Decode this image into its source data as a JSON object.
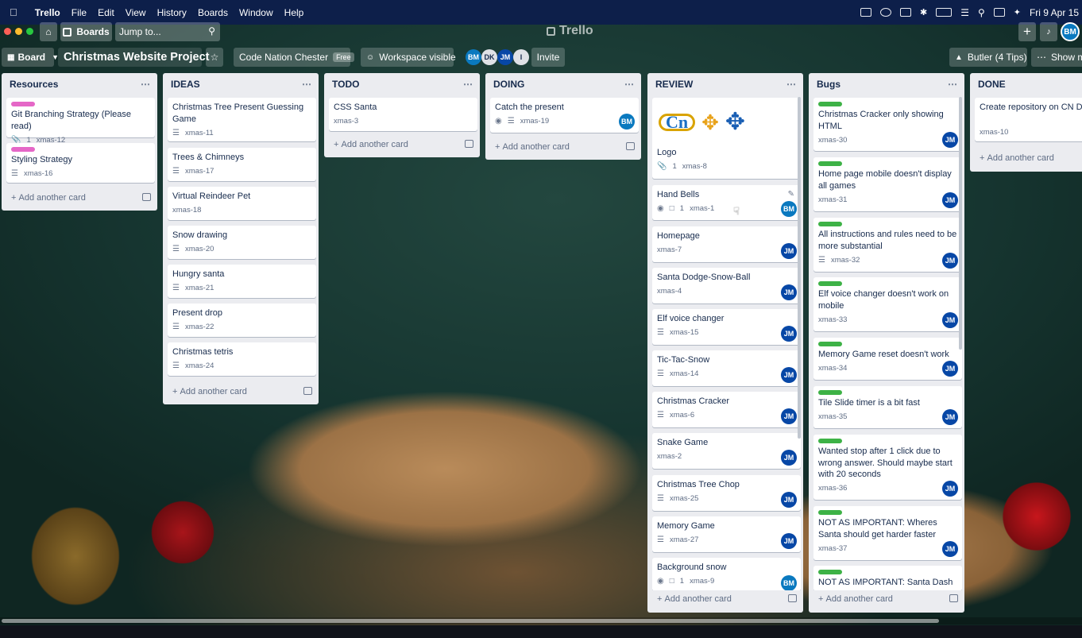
{
  "menubar": {
    "app": "Trello",
    "items": [
      "File",
      "Edit",
      "View",
      "History",
      "Boards",
      "Window",
      "Help"
    ],
    "clock": "Fri 9 Apr  15"
  },
  "nav": {
    "boards": "Boards",
    "search_placeholder": "Jump to...",
    "logo": "Trello",
    "user_initials": "BM"
  },
  "board": {
    "view": "Board",
    "title": "Christmas Website Project",
    "workspace": "Code Nation Chester",
    "plan": "Free",
    "visibility": "Workspace visible",
    "members": [
      "BM",
      "DK",
      "JM",
      "I"
    ],
    "invite": "Invite",
    "butler": "Butler (4 Tips)",
    "show_menu": "Show me"
  },
  "add_card": "Add another card",
  "lists": [
    {
      "title": "Resources",
      "cards": [
        {
          "title": "Git Branching Strategy (Please read)",
          "label": "pink",
          "attach": "1",
          "id": "xmas-12"
        },
        {
          "title": "Styling Strategy",
          "label": "pink",
          "desc": true,
          "id": "xmas-16"
        }
      ]
    },
    {
      "title": "IDEAS",
      "cards": [
        {
          "title": "Christmas Tree Present Guessing Game",
          "desc": true,
          "id": "xmas-11"
        },
        {
          "title": "Trees & Chimneys",
          "desc": true,
          "id": "xmas-17"
        },
        {
          "title": "Virtual Reindeer Pet",
          "id": "xmas-18"
        },
        {
          "title": "Snow drawing",
          "desc": true,
          "id": "xmas-20"
        },
        {
          "title": "Hungry santa",
          "desc": true,
          "id": "xmas-21"
        },
        {
          "title": "Present drop",
          "desc": true,
          "id": "xmas-22"
        },
        {
          "title": "Christmas tetris",
          "desc": true,
          "id": "xmas-24"
        }
      ]
    },
    {
      "title": "TODO",
      "cards": [
        {
          "title": "CSS Santa",
          "id": "xmas-3"
        }
      ]
    },
    {
      "title": "DOING",
      "cards": [
        {
          "title": "Catch the present",
          "watch": true,
          "desc": true,
          "id": "xmas-19",
          "member": "BM"
        }
      ]
    },
    {
      "title": "REVIEW",
      "cards": [
        {
          "title": "Logo",
          "cover": "Cn",
          "attach": "1",
          "id": "xmas-8"
        },
        {
          "title": "Hand Bells",
          "watch": true,
          "comments": "1",
          "id": "xmas-1",
          "member": "BM"
        },
        {
          "title": "Homepage",
          "id": "xmas-7",
          "member": "JM"
        },
        {
          "title": "Santa Dodge-Snow-Ball",
          "id": "xmas-4",
          "member": "JM"
        },
        {
          "title": "Elf voice changer",
          "desc": true,
          "id": "xmas-15",
          "member": "JM"
        },
        {
          "title": "Tic-Tac-Snow",
          "desc": true,
          "id": "xmas-14",
          "member": "JM"
        },
        {
          "title": "Christmas Cracker",
          "desc": true,
          "id": "xmas-6",
          "member": "JM"
        },
        {
          "title": "Snake Game",
          "id": "xmas-2",
          "member": "JM"
        },
        {
          "title": "Christmas Tree Chop",
          "desc": true,
          "id": "xmas-25",
          "member": "JM"
        },
        {
          "title": "Memory Game",
          "desc": true,
          "id": "xmas-27",
          "member": "JM"
        },
        {
          "title": "Background snow",
          "watch": true,
          "comments": "1",
          "id": "xmas-9",
          "member": "BM"
        }
      ]
    },
    {
      "title": "Bugs",
      "cards": [
        {
          "title": "Christmas Cracker only showing HTML",
          "label": "green",
          "id": "xmas-30",
          "member": "JM"
        },
        {
          "title": "Home page mobile doesn't display all games",
          "label": "green",
          "id": "xmas-31",
          "member": "JM"
        },
        {
          "title": "All instructions and rules need to be more substantial",
          "label": "green",
          "desc": true,
          "id": "xmas-32",
          "member": "JM"
        },
        {
          "title": "Elf voice changer doesn't work on mobile",
          "label": "green",
          "id": "xmas-33",
          "member": "JM"
        },
        {
          "title": "Memory Game reset doesn't work",
          "label": "green",
          "id": "xmas-34",
          "member": "JM"
        },
        {
          "title": "Tile Slide timer is a bit fast",
          "label": "green",
          "id": "xmas-35",
          "member": "JM"
        },
        {
          "title": "Wanted stop after 1 click due to wrong answer. Should maybe start with 20 seconds",
          "label": "green",
          "id": "xmas-36",
          "member": "JM"
        },
        {
          "title": "NOT AS IMPORTANT: Wheres Santa should get harder faster",
          "label": "green",
          "id": "xmas-37",
          "member": "JM"
        },
        {
          "title": "NOT AS IMPORTANT: Santa Dash",
          "label": "green"
        }
      ]
    },
    {
      "title": "DONE",
      "cards": [
        {
          "title": "Create repository on CN Digi Github",
          "id": "xmas-10"
        }
      ]
    }
  ],
  "colors": {
    "menubar": "#0d1f4a",
    "list": "#ebecf0",
    "label_pink": "#e567c7",
    "label_green": "#3db246",
    "avatar_jm": "#0747a6",
    "avatar_bm": "#0a79bf"
  }
}
